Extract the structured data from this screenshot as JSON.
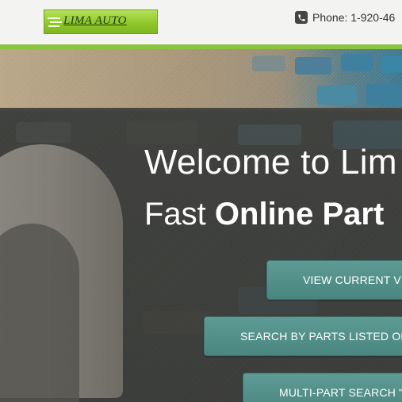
{
  "header": {
    "logo_text": "LIMA AUTO",
    "phone_text": "Phone: 1-920-46",
    "phone_icon": "phone-icon",
    "accent_color": "#8bc53f"
  },
  "hero": {
    "welcome_text": "Welcome to Lim",
    "tagline_prefix": "Fast ",
    "tagline_bold": "Online Part",
    "buttons": [
      {
        "label": "VIEW CURRENT VE"
      },
      {
        "label": "SEARCH BY PARTS LISTED ON"
      },
      {
        "label": "MULTI-PART SEARCH \""
      }
    ],
    "button_color": "#5a938d"
  }
}
